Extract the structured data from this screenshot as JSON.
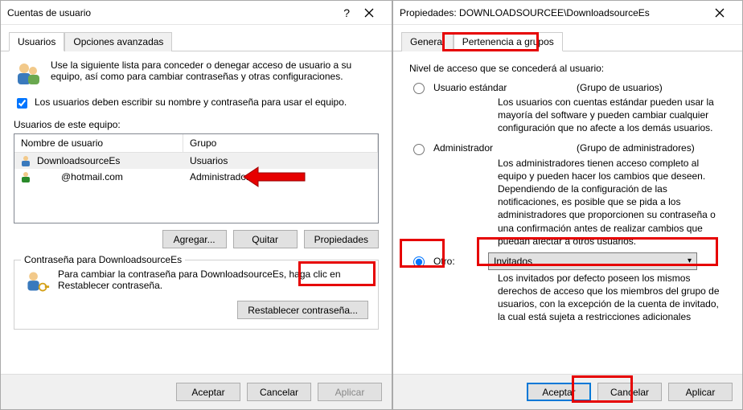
{
  "left_window": {
    "title": "Cuentas de usuario",
    "tabs": {
      "users": "Usuarios",
      "advanced": "Opciones avanzadas"
    },
    "intro": "Use la siguiente lista para conceder o denegar acceso de usuario a su equipo, así como para cambiar contraseñas y otras configuraciones.",
    "checkbox_label": "Los usuarios deben escribir su nombre y contraseña para usar el equipo.",
    "users_label": "Usuarios de este equipo:",
    "columns": {
      "name": "Nombre de usuario",
      "group": "Grupo"
    },
    "rows": [
      {
        "name": "DownloadsourceEs",
        "group": "Usuarios"
      },
      {
        "name": "@hotmail.com",
        "group": "Administradores"
      }
    ],
    "buttons": {
      "add": "Agregar...",
      "remove": "Quitar",
      "properties": "Propiedades"
    },
    "password_box": {
      "legend": "Contraseña para DownloadsourceEs",
      "text": "Para cambiar la contraseña para DownloadsourceEs, haga clic en Restablecer contraseña.",
      "reset_btn": "Restablecer contraseña..."
    },
    "footer": {
      "ok": "Aceptar",
      "cancel": "Cancelar",
      "apply": "Aplicar"
    }
  },
  "right_window": {
    "title": "Propiedades: DOWNLOADSOURCEE\\DownloadsourceEs",
    "tabs": {
      "general": "General",
      "membership": "Pertenencia a grupos"
    },
    "access_label": "Nivel de acceso que se concederá al usuario:",
    "opt_standard": {
      "label": "Usuario estándar",
      "paren": "(Grupo de usuarios)",
      "desc": "Los usuarios con cuentas estándar pueden usar la mayoría del software y pueden cambiar cualquier configuración que no afecte a los demás usuarios."
    },
    "opt_admin": {
      "label": "Administrador",
      "paren": "(Grupo de administradores)",
      "desc": "Los administradores tienen acceso completo al equipo y pueden hacer los cambios que deseen. Dependiendo de la configuración de las notificaciones, es posible que se pida a los administradores que proporcionen su contraseña o una confirmación antes de realizar cambios que puedan afectar a otros usuarios."
    },
    "opt_other": {
      "label": "Otro:",
      "combo_value": "Invitados",
      "desc": "Los invitados por defecto poseen los mismos derechos de acceso que los miembros del grupo de usuarios, con  la excepción de la cuenta de invitado, la cual está sujeta a restricciones adicionales"
    },
    "footer": {
      "ok": "Aceptar",
      "cancel": "Cancelar",
      "apply": "Aplicar"
    }
  }
}
